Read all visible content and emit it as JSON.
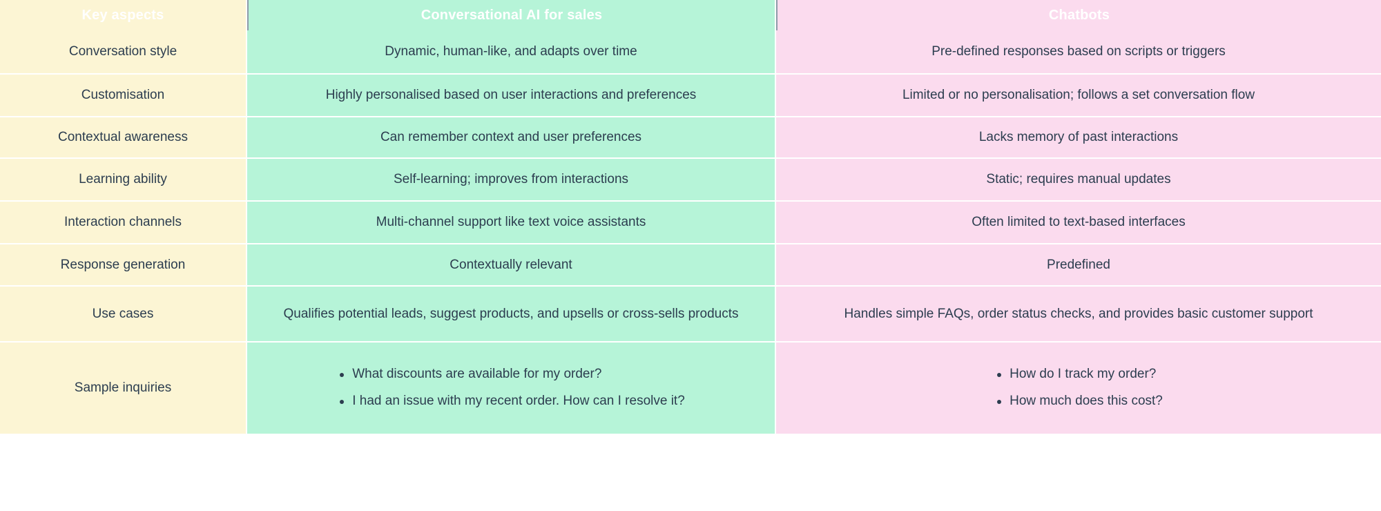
{
  "table": {
    "headers": [
      {
        "label": "Key aspects"
      },
      {
        "label": "Conversational AI for sales"
      },
      {
        "label": "Chatbots"
      }
    ],
    "colors": {
      "header_bg": "#2f4053",
      "header_text": "#ffffff",
      "aspect_bg": "#fcf5d4",
      "ai_bg": "#b6f4d8",
      "chatbot_bg": "#fbdbee",
      "body_text": "#2c3d4f",
      "grid_line": "#ffffff"
    },
    "rows": [
      {
        "aspect": "Conversation style",
        "ai": "Dynamic, human-like, and adapts over time",
        "chatbot": "Pre-defined responses based on scripts or triggers"
      },
      {
        "aspect": "Customisation",
        "ai": "Highly personalised based on user interactions and preferences",
        "chatbot": "Limited or no personalisation; follows a set conversation flow"
      },
      {
        "aspect": "Contextual awareness",
        "ai": "Can remember context and user preferences",
        "chatbot": "Lacks memory of past interactions"
      },
      {
        "aspect": "Learning ability",
        "ai": "Self-learning; improves from interactions",
        "chatbot": "Static; requires manual updates"
      },
      {
        "aspect": "Interaction channels",
        "ai": "Multi-channel support like text voice assistants",
        "chatbot": "Often limited to text-based interfaces"
      },
      {
        "aspect": "Response generation",
        "ai": "Contextually relevant",
        "chatbot": "Predefined"
      },
      {
        "aspect": "Use cases",
        "ai": "Qualifies potential leads, suggest products, and upsells or cross-sells products",
        "chatbot": "Handles simple FAQs, order status checks, and provides basic customer support"
      },
      {
        "aspect": "Sample inquiries",
        "ai_bullets": [
          "What discounts are available for my order?",
          "I had an issue with my recent order. How can I resolve it?"
        ],
        "chatbot_bullets": [
          "How do I track my order?",
          "How much does this cost?"
        ]
      }
    ]
  }
}
